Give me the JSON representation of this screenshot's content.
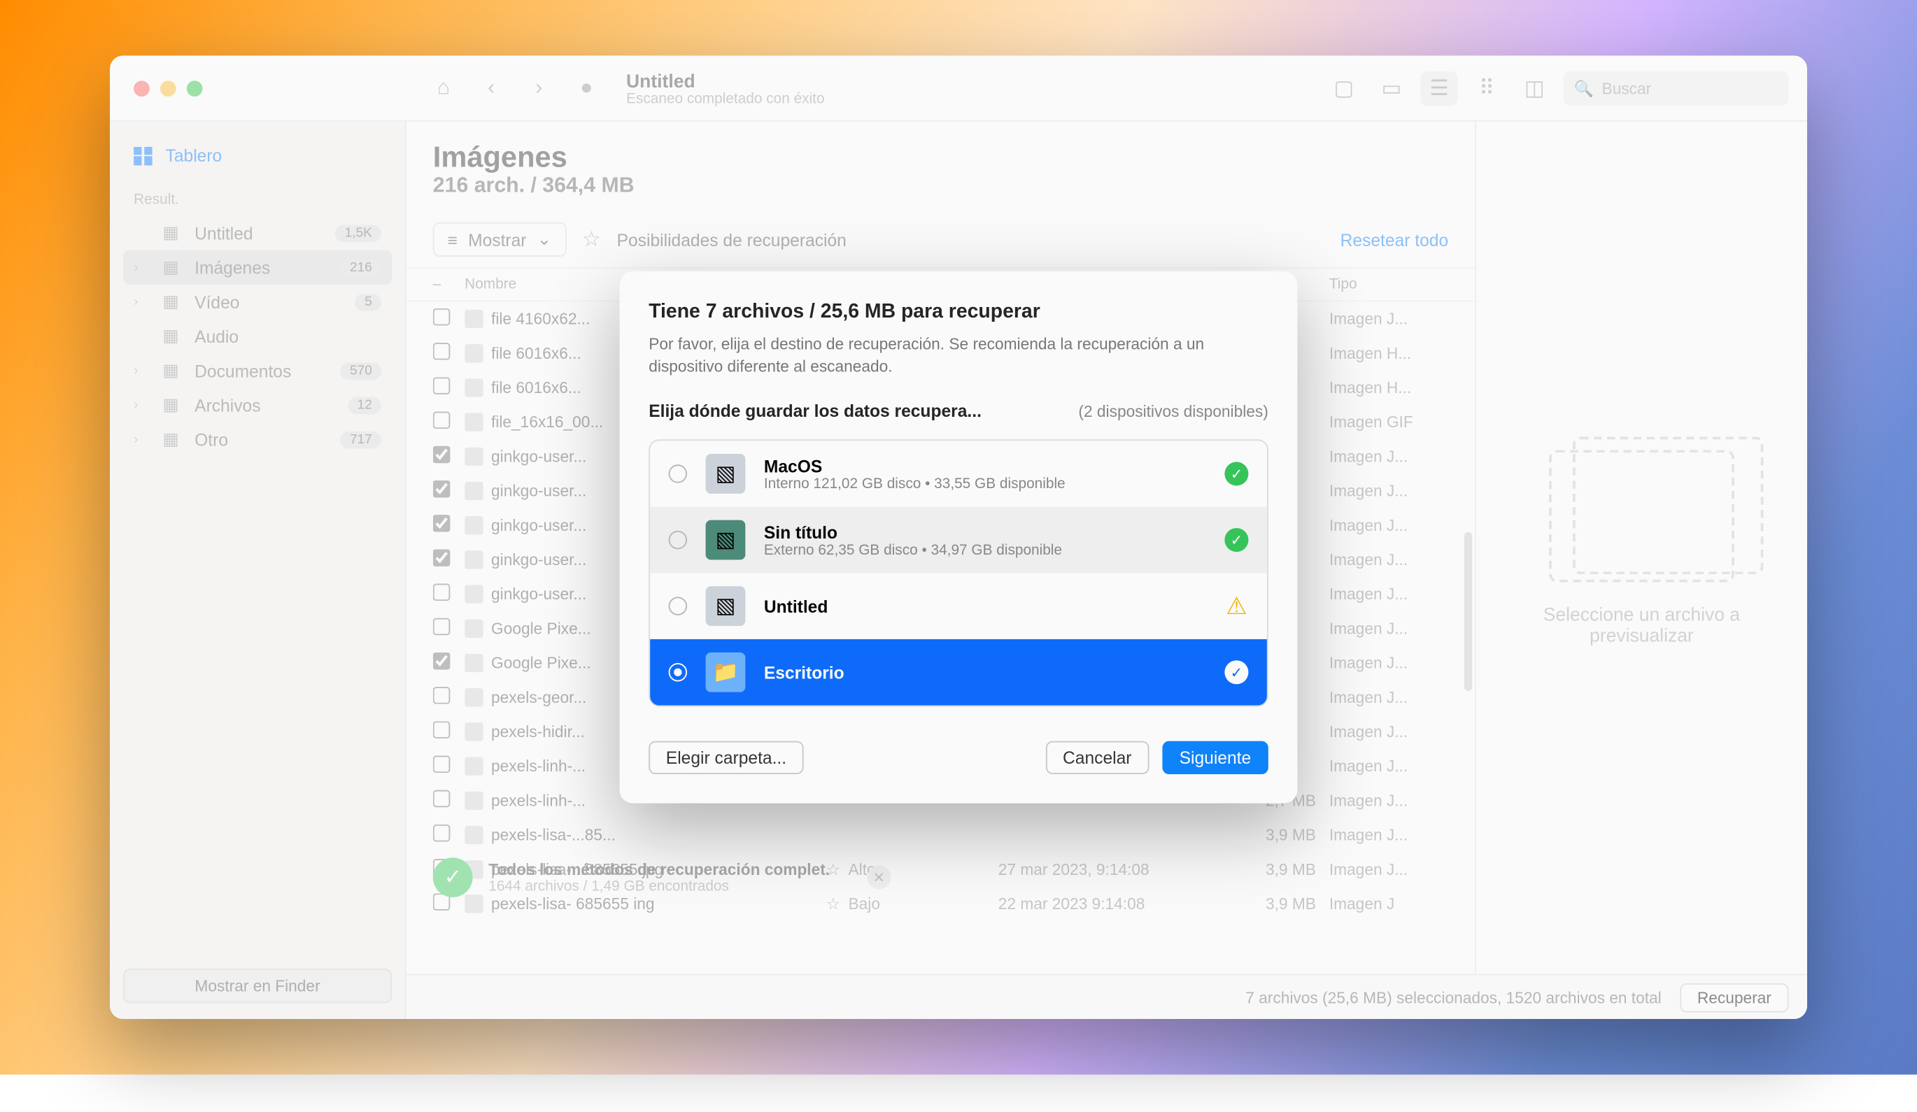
{
  "sidebar": {
    "dashboard": "Tablero",
    "section": "Result.",
    "items": [
      {
        "label": "Untitled",
        "badge": "1,5K",
        "icon": "drive"
      },
      {
        "label": "Imágenes",
        "badge": "216",
        "icon": "image",
        "active": true,
        "chev": true
      },
      {
        "label": "Vídeo",
        "badge": "5",
        "icon": "video",
        "chev": true
      },
      {
        "label": "Audio",
        "badge": "",
        "icon": "audio"
      },
      {
        "label": "Documentos",
        "badge": "570",
        "icon": "doc",
        "chev": true
      },
      {
        "label": "Archivos",
        "badge": "12",
        "icon": "archive",
        "chev": true
      },
      {
        "label": "Otro",
        "badge": "717",
        "icon": "other",
        "chev": true
      }
    ],
    "finder_btn": "Mostrar en Finder"
  },
  "toolbar": {
    "title": "Untitled",
    "subtitle": "Escaneo completado con éxito",
    "search_placeholder": "Buscar"
  },
  "header": {
    "title": "Imágenes",
    "subtitle": "216 arch. / 364,4 MB"
  },
  "filter": {
    "show": "Mostrar",
    "recovery_chance": "Posibilidades de recuperación",
    "reset": "Resetear todo"
  },
  "columns": {
    "name": "Nombre",
    "type": "Tipo"
  },
  "rows": [
    {
      "chk": false,
      "name": "file 4160x62...",
      "size": "",
      "type": "Imagen J..."
    },
    {
      "chk": false,
      "name": "file 6016x6...",
      "size": "",
      "type": "Imagen H..."
    },
    {
      "chk": false,
      "name": "file 6016x6...",
      "size": "",
      "type": "Imagen H..."
    },
    {
      "chk": false,
      "name": "file_16x16_00...",
      "size": "",
      "type": "Imagen GIF"
    },
    {
      "chk": true,
      "name": "ginkgo-user...",
      "size": "",
      "type": "Imagen J..."
    },
    {
      "chk": true,
      "name": "ginkgo-user...",
      "size": "",
      "type": "Imagen J..."
    },
    {
      "chk": true,
      "name": "ginkgo-user...",
      "size": "",
      "type": "Imagen J..."
    },
    {
      "chk": true,
      "name": "ginkgo-user...",
      "size": "",
      "type": "Imagen J..."
    },
    {
      "chk": false,
      "name": "ginkgo-user...",
      "size": "",
      "type": "Imagen J..."
    },
    {
      "chk": false,
      "name": "Google Pixe...",
      "size": "",
      "type": "Imagen J..."
    },
    {
      "chk": true,
      "name": "Google Pixe...",
      "size": "",
      "type": "Imagen J..."
    },
    {
      "chk": false,
      "name": "pexels-geor...",
      "size": "",
      "type": "Imagen J..."
    },
    {
      "chk": false,
      "name": "pexels-hidir...",
      "size": "",
      "type": "Imagen J..."
    },
    {
      "chk": false,
      "name": "pexels-linh-...",
      "size": "",
      "type": "Imagen J..."
    },
    {
      "chk": false,
      "name": "pexels-linh-...",
      "size": "2,7 MB",
      "type": "Imagen J..."
    },
    {
      "chk": false,
      "name": "pexels-lisa-...85...",
      "size": "3,9 MB",
      "type": "Imagen J..."
    },
    {
      "chk": false,
      "name": "pexels-lisa-...685655.jpg",
      "chance": "Alto",
      "date": "27 mar 2023, 9:14:08",
      "size": "3,9 MB",
      "type": "Imagen J..."
    },
    {
      "chk": false,
      "name": "pexels-lisa-    685655 ing",
      "chance": "Bajo",
      "date": "22 mar 2023  9:14:08",
      "size": "3,9 MB",
      "type": "Imagen J"
    }
  ],
  "completion": {
    "title": "Todos los métodos de recuperación complet.",
    "subtitle": "1644 archivos / 1,49 GB encontrados"
  },
  "status": {
    "text": "7 archivos (25,6 MB) seleccionados, 1520 archivos en total",
    "recover": "Recuperar"
  },
  "preview": {
    "text": "Seleccione un archivo a previsualizar"
  },
  "modal": {
    "title": "Tiene 7 archivos / 25,6 MB para recuperar",
    "desc": "Por favor, elija el destino de recuperación. Se recomienda la recuperación a un dispositivo diferente al escaneado.",
    "choose_label": "Elija dónde guardar los datos recupera...",
    "devices_label": "(2 dispositivos disponibles)",
    "destinations": [
      {
        "name": "MacOS",
        "sub": "Interno 121,02 GB disco • 33,55 GB disponible",
        "status": "ok",
        "icon": "hdd"
      },
      {
        "name": "Sin título",
        "sub": "Externo 62,35 GB disco • 34,97 GB disponible",
        "status": "ok",
        "icon": "tm",
        "hover": true
      },
      {
        "name": "Untitled",
        "sub": "",
        "status": "warn",
        "icon": "ext"
      },
      {
        "name": "Escritorio",
        "sub": "",
        "status": "ok",
        "icon": "folder",
        "selected": true
      }
    ],
    "choose_folder": "Elegir carpeta...",
    "cancel": "Cancelar",
    "next": "Siguiente"
  }
}
